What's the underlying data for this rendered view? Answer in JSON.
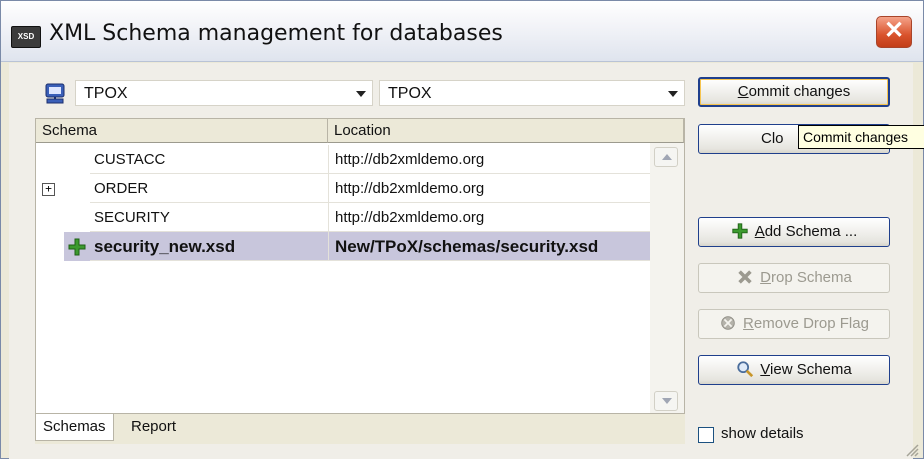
{
  "window": {
    "title": "XML Schema management for databases",
    "app_icon_text": "XSD"
  },
  "source_db": {
    "value": "TPOX"
  },
  "target_db": {
    "value": "TPOX"
  },
  "grid": {
    "columns": [
      "Schema",
      "Location"
    ],
    "rows": [
      {
        "schema": "CUSTACC",
        "location": "http://db2xmldemo.org",
        "expandable": false,
        "selected": false
      },
      {
        "schema": "ORDER",
        "location": "http://db2xmldemo.org",
        "expandable": true,
        "selected": false
      },
      {
        "schema": "SECURITY",
        "location": "http://db2xmldemo.org",
        "expandable": false,
        "selected": false
      },
      {
        "schema": "security_new.xsd",
        "location": "New/TPoX/schemas/security.xsd",
        "expandable": false,
        "selected": true,
        "new": true
      }
    ],
    "expander_symbol": "+"
  },
  "tabs": [
    "Schemas",
    "Report"
  ],
  "buttons": {
    "commit": {
      "pre": "",
      "key": "C",
      "post": "ommit changes"
    },
    "close": {
      "text": "Clo"
    },
    "add_schema": {
      "pre": "",
      "key": "A",
      "post": "dd Schema ..."
    },
    "drop_schema": {
      "pre": "",
      "key": "D",
      "post": "rop Schema"
    },
    "remove_drop_flag": {
      "pre": "",
      "key": "R",
      "post": "emove Drop Flag"
    },
    "view_schema": {
      "pre": "",
      "key": "V",
      "post": "iew Schema"
    }
  },
  "tooltip": {
    "text": "Commit changes"
  },
  "show_details": {
    "label": "show details",
    "checked": false
  },
  "colors": {
    "selection": "#c8c6dc",
    "default_button_border": "#1f3f8c",
    "close_button": "#d9532c",
    "add_icon": "#3c9a2f"
  },
  "icons": [
    "database-icon",
    "close-icon",
    "add-icon",
    "drop-icon",
    "remove-flag-icon",
    "magnifier-icon"
  ]
}
